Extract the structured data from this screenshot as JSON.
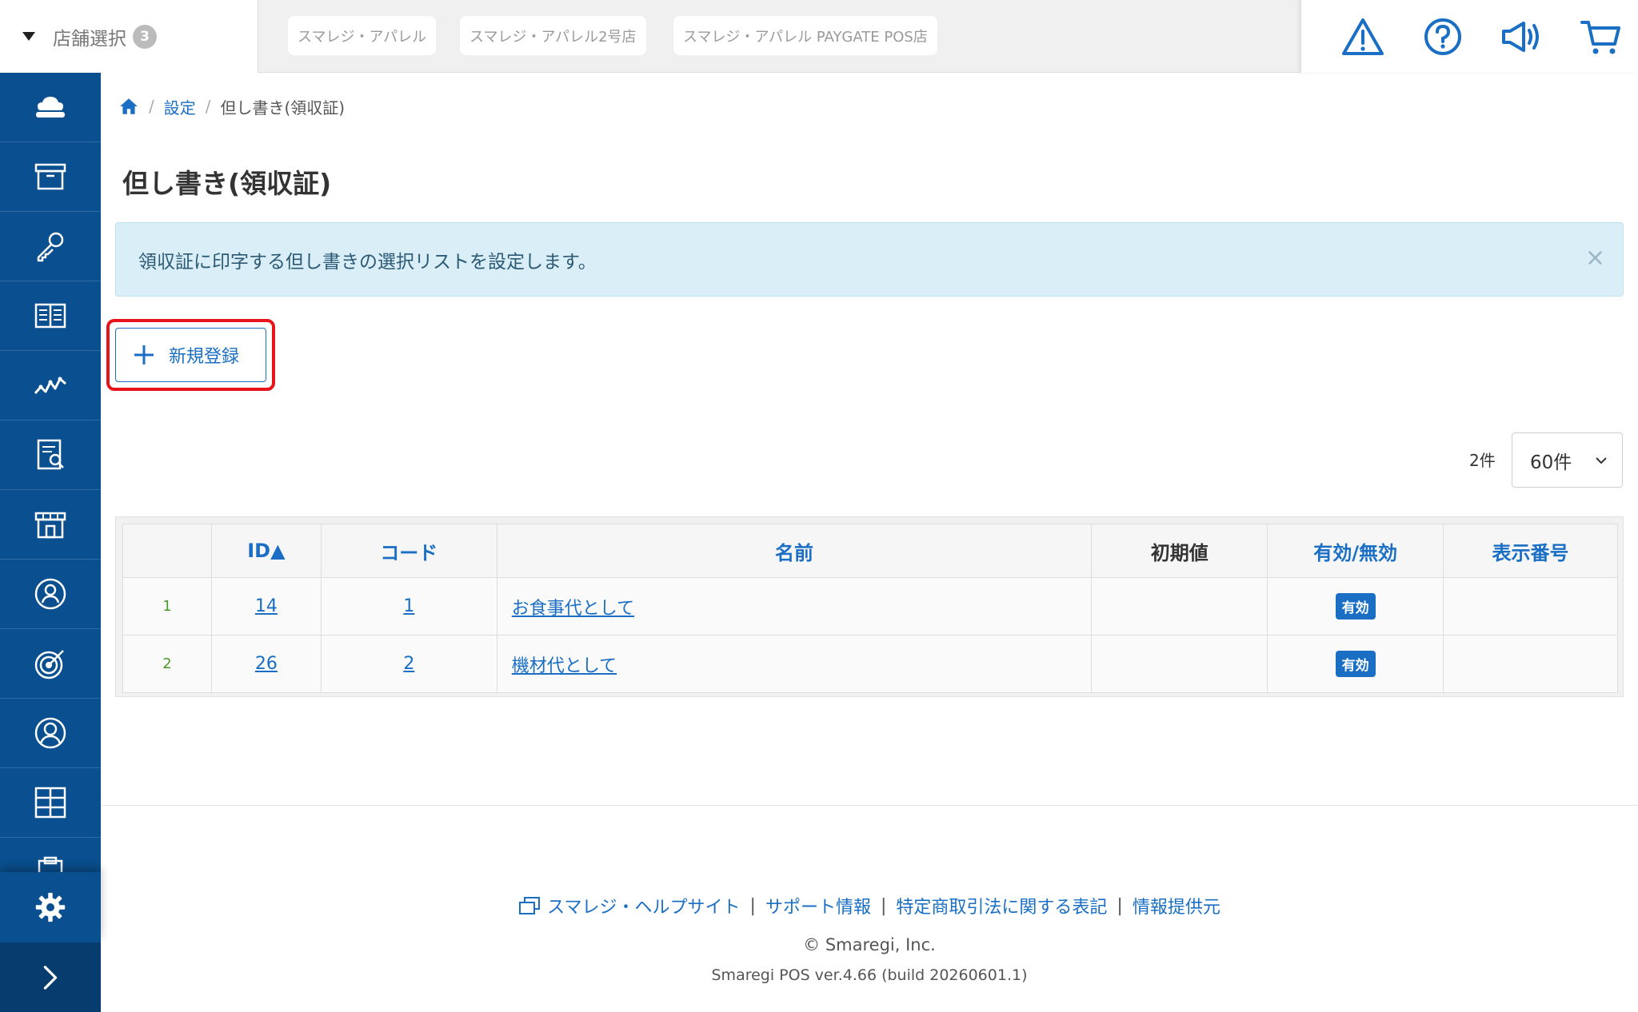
{
  "store_select": {
    "label": "店舗選択",
    "count": "3"
  },
  "stores": [
    "スマレジ・アパレル",
    "スマレジ・アパレル2号店",
    "スマレジ・アパレル PAYGATE POS店"
  ],
  "top_icons": [
    "warning-icon",
    "help-icon",
    "megaphone-icon",
    "cart-icon"
  ],
  "sidebar": {
    "items": [
      "cloud-icon",
      "archive-box-icon",
      "key-icon",
      "book-icon",
      "chart-line-icon",
      "report-icon",
      "store-icon",
      "staff-icon",
      "target-icon",
      "customer-icon",
      "grid-icon",
      "clipboard-icon"
    ],
    "settings_icon": "gear-icon",
    "expand_icon": "chevron-right-icon"
  },
  "breadcrumb": {
    "home_icon": "home-icon",
    "settings": "設定",
    "current": "但し書き(領収証)"
  },
  "page": {
    "title": "但し書き(領収証)",
    "info": "領収証に印字する但し書きの選択リストを設定します。",
    "close": "×",
    "new_button": "新規登録"
  },
  "pagination": {
    "count": "2件",
    "per_page": "60件"
  },
  "table": {
    "headers": [
      "",
      "ID▲",
      "コード",
      "名前",
      "初期値",
      "有効/無効",
      "表示番号"
    ],
    "rows": [
      {
        "no": "1",
        "id": "14",
        "code": "1",
        "name": "お食事代として",
        "default": "",
        "status": "有効",
        "order": ""
      },
      {
        "no": "2",
        "id": "26",
        "code": "2",
        "name": "機材代として",
        "default": "",
        "status": "有効",
        "order": ""
      }
    ]
  },
  "footer": {
    "help": "スマレジ・ヘルプサイト",
    "support": "サポート情報",
    "law": "特定商取引法に関する表記",
    "provider": "情報提供元",
    "copyright": "© Smaregi, Inc.",
    "version": "Smaregi POS ver.4.66 (build 20260601.1)"
  },
  "colors": {
    "sidebar": "#0a4f8f",
    "accent": "#1a6fc4",
    "info_bg": "#d9eef7",
    "highlight": "#e8141c"
  }
}
